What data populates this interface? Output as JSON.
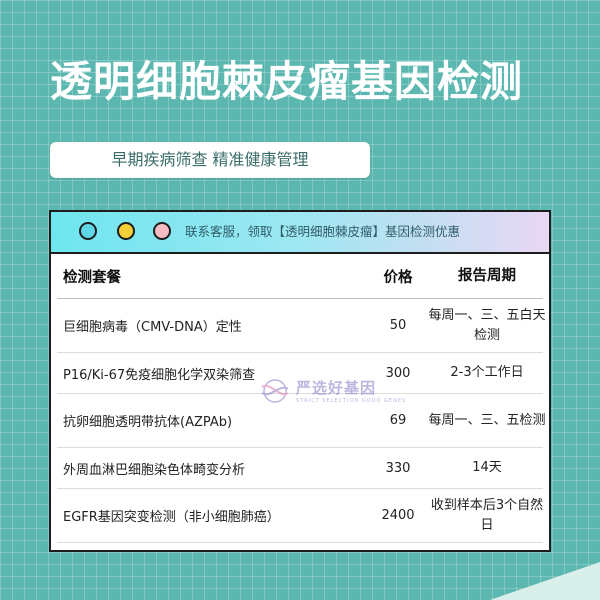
{
  "title": "透明细胞棘皮瘤基因检测",
  "subtitle": "早期疾病筛查 精准健康管理",
  "card": {
    "notice": "联系客服，领取【透明细胞棘皮瘤】基因检测优惠",
    "dots": [
      {
        "name": "cyan",
        "color": "#5fd6e6"
      },
      {
        "name": "yellow",
        "color": "#f4cf3a"
      },
      {
        "name": "pink",
        "color": "#f6bcc3"
      }
    ]
  },
  "table": {
    "headers": {
      "name": "检测套餐",
      "price": "价格",
      "cycle": "报告周期"
    },
    "rows": [
      {
        "name": "巨细胞病毒（CMV-DNA）定性",
        "price": "50",
        "cycle": "每周一、三、五白天检测"
      },
      {
        "name": "P16/Ki-67免疫细胞化学双染筛查",
        "price": "300",
        "cycle": "2-3个工作日"
      },
      {
        "name": "抗卵细胞透明带抗体(AZPAb)",
        "price": "69",
        "cycle": "每周一、三、五检测"
      },
      {
        "name": "外周血淋巴细胞染色体畸变分析",
        "price": "330",
        "cycle": "14天"
      },
      {
        "name": "EGFR基因突变检测（非小细胞肺癌）",
        "price": "2400",
        "cycle": "收到样本后3个自然日"
      }
    ]
  },
  "watermark": {
    "text": "严选好基因",
    "sub": "STRICT SELECTION GOOD GENES"
  },
  "colors": {
    "background": "#5bb7b0",
    "title": "#ffffff",
    "accent": "#3a6d6a"
  }
}
